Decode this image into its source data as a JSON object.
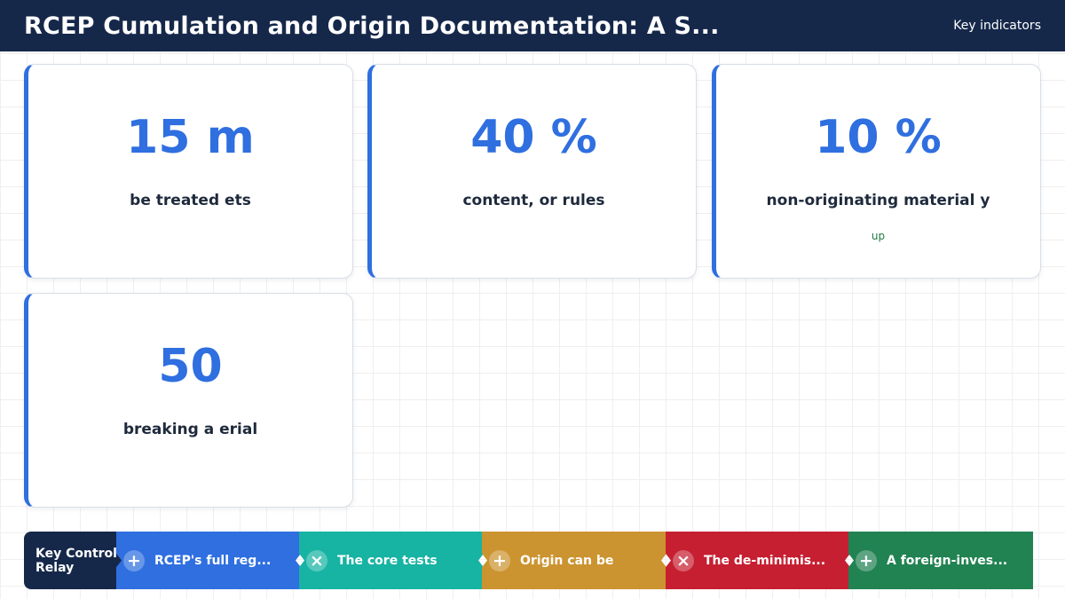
{
  "header": {
    "title": "RCEP Cumulation and Origin Documentation: A S...",
    "right_label": "Key indicators"
  },
  "cards": [
    {
      "value": "15 m",
      "label": "be treated ets",
      "sub": ""
    },
    {
      "value": "40 %",
      "label": "content, or rules",
      "sub": ""
    },
    {
      "value": "10 %",
      "label": "non-originating material y",
      "sub": "up"
    },
    {
      "value": "50",
      "label": "breaking a erial",
      "sub": ""
    }
  ],
  "relay": {
    "title": "Key Control Relay",
    "segments": [
      {
        "icon": "plus-icon",
        "symbol": "+",
        "label": "RCEP's full reg...",
        "color": "#2f6fe0"
      },
      {
        "icon": "close-icon",
        "symbol": "×",
        "label": "The core tests",
        "color": "#17b3a3"
      },
      {
        "icon": "plus-icon",
        "symbol": "+",
        "label": "Origin can be",
        "color": "#cc9430"
      },
      {
        "icon": "close-icon",
        "symbol": "×",
        "label": "The de-minimis...",
        "color": "#c61f31"
      },
      {
        "icon": "plus-icon",
        "symbol": "+",
        "label": "A foreign-inves...",
        "color": "#218252"
      }
    ]
  },
  "colors": {
    "header_bg": "#16284a",
    "accent": "#2f6fe0",
    "sub_text": "#1f7a44"
  }
}
